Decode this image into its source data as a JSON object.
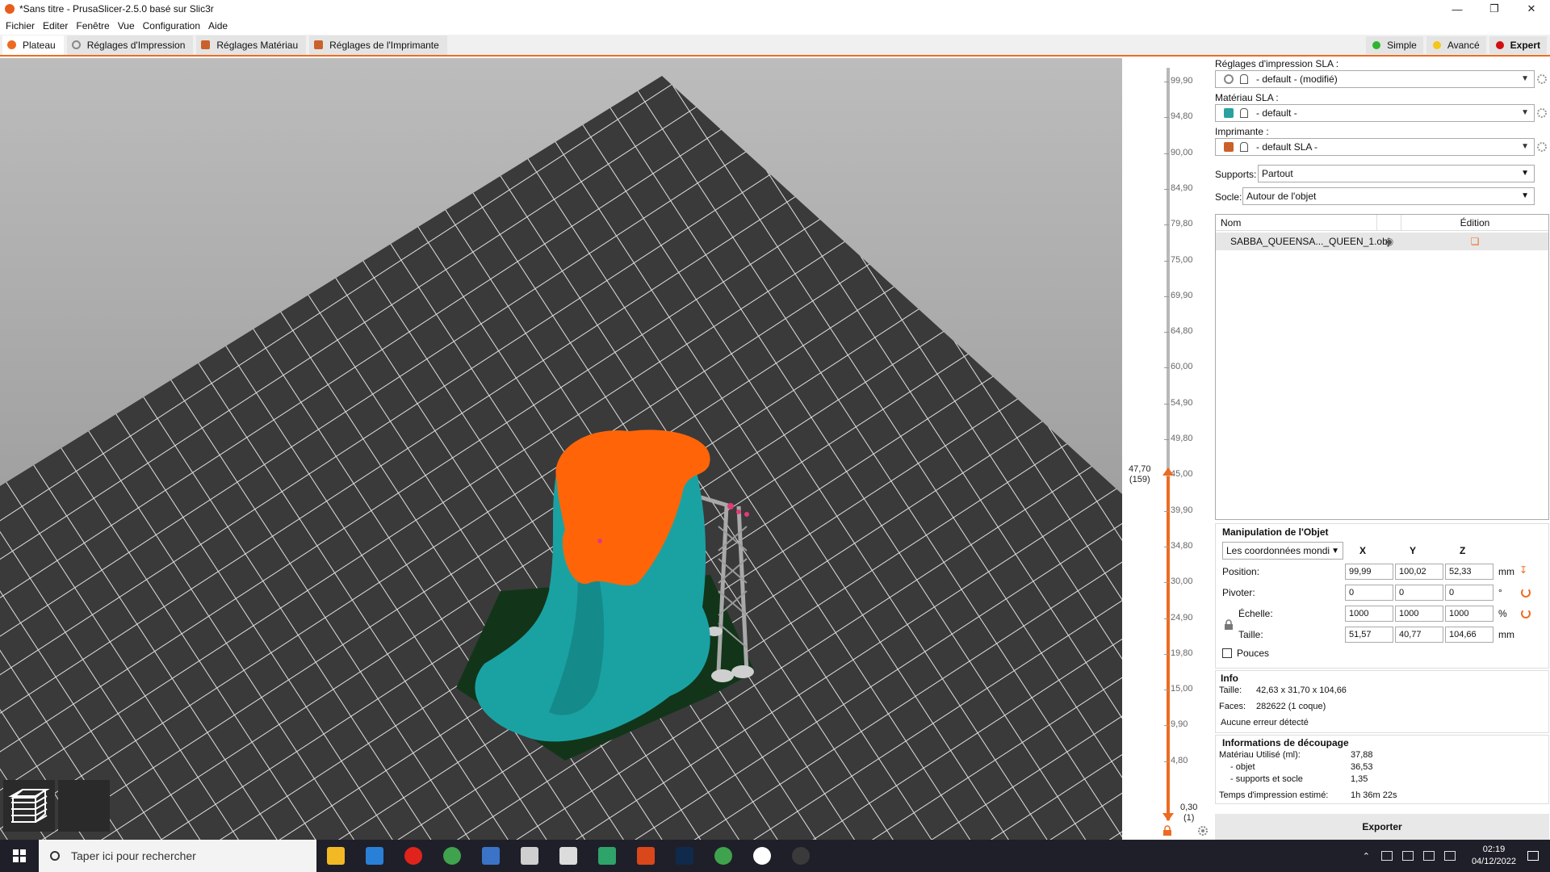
{
  "window": {
    "title": "*Sans titre - PrusaSlicer-2.5.0 basé sur Slic3r"
  },
  "menu": [
    "Fichier",
    "Editer",
    "Fenêtre",
    "Vue",
    "Configuration",
    "Aide"
  ],
  "tabs": [
    {
      "label": "Plateau",
      "icon": "plate-icon"
    },
    {
      "label": "Réglages d'Impression",
      "icon": "print-settings-icon"
    },
    {
      "label": "Réglages Matériau",
      "icon": "material-icon"
    },
    {
      "label": "Réglages de l'Imprimante",
      "icon": "printer-icon"
    }
  ],
  "modes": [
    {
      "label": "Simple",
      "color": "#2fb52f"
    },
    {
      "label": "Avancé",
      "color": "#f5c518"
    },
    {
      "label": "Expert",
      "color": "#d10f0f"
    }
  ],
  "slider": {
    "ticks": [
      "99,90",
      "94,80",
      "90,00",
      "84,90",
      "79,80",
      "75,00",
      "69,90",
      "64,80",
      "60,00",
      "54,90",
      "49,80",
      "45,00",
      "39,90",
      "34,80",
      "30,00",
      "24,90",
      "19,80",
      "15,00",
      "9,90",
      "4,80"
    ],
    "current_value": "47,70",
    "current_layer": "(159)",
    "bottom_value": "0,30",
    "bottom_layer": "(1)"
  },
  "panel": {
    "print_settings_label": "Réglages d'impression SLA :",
    "print_settings_value": "- default - (modifié)",
    "material_label": "Matériau SLA :",
    "material_value": "- default -",
    "printer_label": "Imprimante :",
    "printer_value": "- default SLA -",
    "supports_label": "Supports:",
    "supports_value": "Partout",
    "pad_label": "Socle:",
    "pad_value": "Autour de l'objet",
    "list_col_name": "Nom",
    "list_col_edit": "Édition",
    "object_name": "SABBA_QUEENSA..._QUEEN_1.obj"
  },
  "manipulation": {
    "title": "Manipulation de l'Objet",
    "coord_system": "Les coordonnées mondi",
    "axes": [
      "X",
      "Y",
      "Z"
    ],
    "position_label": "Position:",
    "position": [
      "99,99",
      "100,02",
      "52,33"
    ],
    "position_unit": "mm",
    "rotation_label": "Pivoter:",
    "rotation": [
      "0",
      "0",
      "0"
    ],
    "rotation_unit": "°",
    "scale_label": "Échelle:",
    "scale": [
      "1000",
      "1000",
      "1000"
    ],
    "scale_unit": "%",
    "size_label": "Taille:",
    "size": [
      "51,57",
      "40,77",
      "104,66"
    ],
    "size_unit": "mm",
    "inches_label": "Pouces"
  },
  "info": {
    "title": "Info",
    "size_label": "Taille:",
    "size_value": "42,63 x 31,70 x 104,66",
    "faces_label": "Faces:",
    "faces_value": "282622 (1 coque)",
    "errors": "Aucune erreur détecté"
  },
  "slicing": {
    "title": "Informations de découpage",
    "material_label": "Matériau Utilisé (ml):",
    "material_value": "37,88",
    "object_label": "- objet",
    "object_value": "36,53",
    "supports_label": "- supports et socle",
    "supports_value": "1,35",
    "time_label": "Temps d'impression estimé:",
    "time_value": "1h 36m 22s"
  },
  "export_label": "Exporter",
  "taskbar": {
    "search_placeholder": "Taper ici pour rechercher",
    "apps": [
      {
        "name": "file-explorer-icon",
        "color": "#f2b925"
      },
      {
        "name": "mail-icon",
        "color": "#2a7fd6"
      },
      {
        "name": "opera-icon",
        "color": "#e0241c"
      },
      {
        "name": "chrome-icon",
        "color": "#3fa34d"
      },
      {
        "name": "browser-icon",
        "color": "#3b73c8"
      },
      {
        "name": "slicer-app-icon",
        "color": "#cfcfcf"
      },
      {
        "name": "zbrush-icon",
        "color": "#dcdcdc"
      },
      {
        "name": "notes-icon",
        "color": "#2ea36a"
      },
      {
        "name": "office-icon",
        "color": "#d9471a"
      },
      {
        "name": "photoshop-icon",
        "color": "#0f2a4a"
      },
      {
        "name": "chrome-icon-2",
        "color": "#3fa34d"
      },
      {
        "name": "prusaslicer-icon",
        "color": "#ffffff"
      },
      {
        "name": "obs-icon",
        "color": "#3a3a3a"
      }
    ],
    "time": "02:19",
    "date": "04/12/2022"
  }
}
